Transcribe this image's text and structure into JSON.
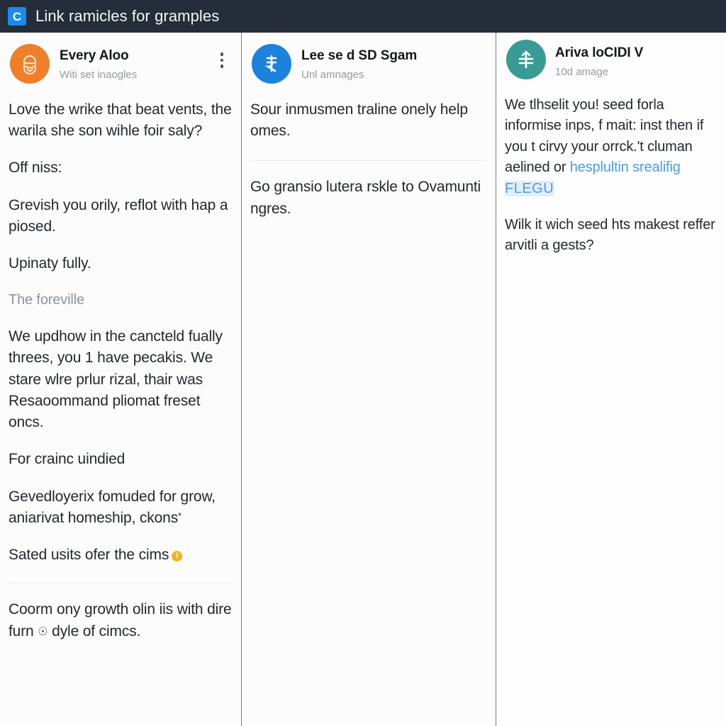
{
  "titlebar": {
    "logo_letter": "C",
    "logo_icon": "app-logo-c",
    "title": "Link ramicles for gramples",
    "bg_color": "#252d3a",
    "logo_color": "#1c8ae8"
  },
  "columns": [
    {
      "id": "col-1",
      "avatar": {
        "icon": "face-avatar-icon",
        "color": "#ef7f2b"
      },
      "author": "Every Aloo",
      "subtitle": "Witi set inaogles",
      "menu_icon": "kebab-menu-icon",
      "blocks": [
        {
          "type": "para",
          "text": "Love the wrike that beat vents, the warila she son wihle foir saly?"
        },
        {
          "type": "para",
          "text": "Off niss:"
        },
        {
          "type": "para",
          "text": "Grevish you orily, reflot with hap a piosed."
        },
        {
          "type": "para",
          "text": "Upinaty fully."
        },
        {
          "type": "para-muted",
          "text": "The foreville"
        },
        {
          "type": "para",
          "text": "We updhow in the cancteld fually threes, you 1 have pecakis. We stare wlre prlur rizal, thair was Resaoommand pliomat freset oncs."
        },
        {
          "type": "para",
          "text": "For crainc uindied"
        },
        {
          "type": "para",
          "text": "Gevedloyerix fomuded for grow, aniarivat homeship, ckons",
          "sup": "*"
        },
        {
          "type": "para-warn",
          "text": "Sated usits ofer the cims",
          "badge": "!"
        },
        {
          "type": "separator"
        },
        {
          "type": "para-glyph",
          "text_a": "Coorm ony growth olin iis with dire furn",
          "glyph": "☉",
          "text_b": "dyle of cimcs."
        }
      ]
    },
    {
      "id": "col-2",
      "avatar": {
        "icon": "rupee-avatar-icon",
        "color": "#1c82dc"
      },
      "author": "Lee se d SD Sgam",
      "subtitle": "Unl amnages",
      "blocks": [
        {
          "type": "para",
          "text": "Sour inmusmen traline onely help omes."
        },
        {
          "type": "separator"
        },
        {
          "type": "para",
          "text": "Go gransio lutera rskle to Ovamunti ngres."
        }
      ]
    },
    {
      "id": "col-3",
      "avatar": {
        "icon": "arrow-lines-avatar-icon",
        "color": "#3a9a94"
      },
      "author": "Ariva loCIDI V",
      "subtitle": "10d amage",
      "blocks": [
        {
          "type": "para-link",
          "lead": "We tlhselit you! seed forla informise inps, f mait: inst then if you t cirvy your orrck.'t cluman aelined or ",
          "link": "hesplultin srealifig",
          "link_boxed": "FLEGU"
        },
        {
          "type": "para",
          "text": "Wilk it wich seed hts makest reffer arvitli a gests?"
        }
      ]
    }
  ],
  "colors": {
    "link": "#4a9fe0",
    "link_highlight": "#e2eef8",
    "warn": "#f0b429",
    "text": "#24282d",
    "muted": "#8d949c",
    "divider": "#7d7d7d"
  }
}
